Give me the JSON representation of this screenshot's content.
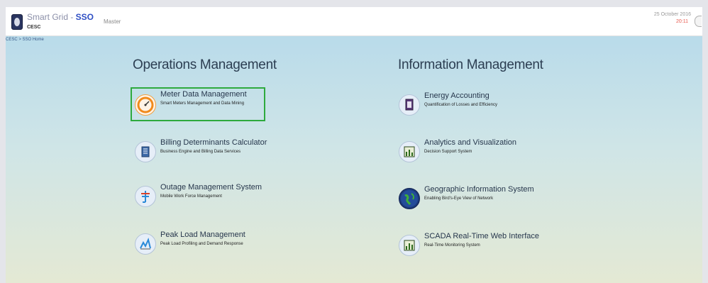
{
  "header": {
    "app_title_prefix": "Smart Grid - ",
    "app_title_suffix": "SSO",
    "org": "CESC",
    "menu_master": "Master",
    "date": "25 October 2016",
    "time": "20:11"
  },
  "breadcrumb": "CESC > SSO Home",
  "sections": {
    "operations": {
      "title": "Operations Management",
      "items": [
        {
          "title": "Meter Data Management",
          "subtitle": "Smart Meters Management and Data Mining",
          "icon": "speedometer-icon"
        },
        {
          "title": "Billing Determinants Calculator",
          "subtitle": "Business Engine and Billing Data Services",
          "icon": "document-icon"
        },
        {
          "title": "Outage Management System",
          "subtitle": "Mobile Work Force Management",
          "icon": "power-tower-icon"
        },
        {
          "title": "Peak Load Management",
          "subtitle": "Peak Load Profiling and Demand Response",
          "icon": "peak-chart-icon"
        }
      ]
    },
    "information": {
      "title": "Information Management",
      "items": [
        {
          "title": "Energy Accounting",
          "subtitle": "Quantification of Losses and Efficiency",
          "icon": "clipboard-icon"
        },
        {
          "title": "Analytics and Visualization",
          "subtitle": "Decision Support System",
          "icon": "bar-chart-icon"
        },
        {
          "title": "Geographic Information System",
          "subtitle": "Enabling Bird's-Eye View of Network",
          "icon": "globe-icon"
        },
        {
          "title": "SCADA Real-Time Web Interface",
          "subtitle": "Real-Time Monitoring System",
          "icon": "monitor-chart-icon"
        }
      ]
    }
  },
  "colors": {
    "selection_border": "#2eaa3e",
    "brand_blue": "#2f4fc4",
    "time_red": "#e8584d"
  }
}
